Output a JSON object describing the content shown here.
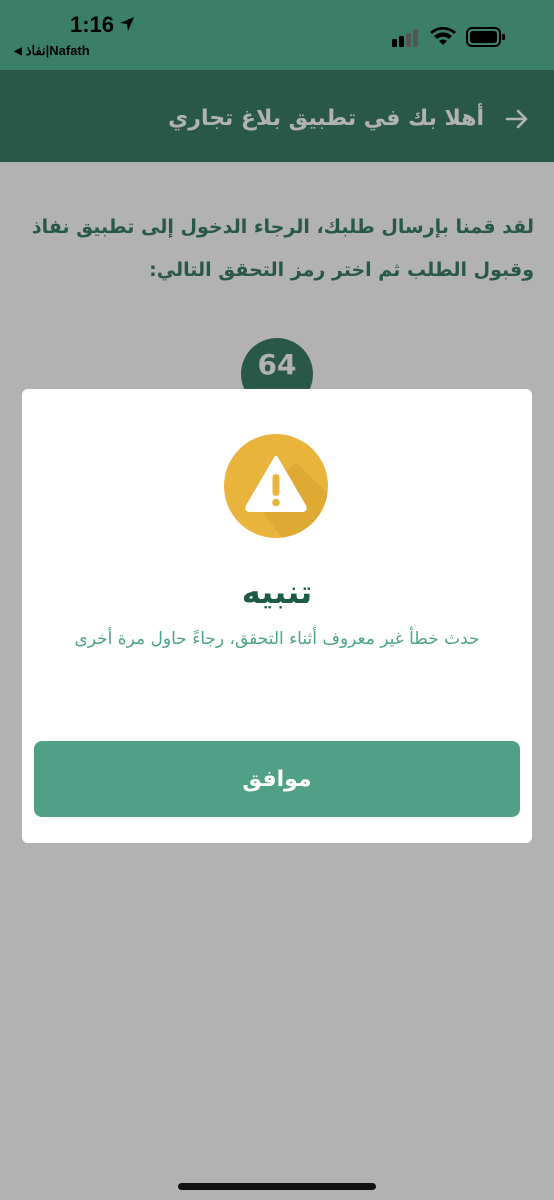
{
  "status_bar": {
    "time": "1:16",
    "back_app": "نفاذ|Nafath"
  },
  "header": {
    "title": "أهلا بك في تطبيق بلاغ تجاري"
  },
  "content": {
    "instructions": "لقد قمنا بإرسال طلبك، الرجاء الدخول إلى تطبيق نفاذ وقبول الطلب ثم اختر رمز التحقق التالي:",
    "verification_code": "64"
  },
  "dialog": {
    "icon": "warning-icon",
    "title": "تنبيه",
    "message": "حدث خطأ غير معروف أثناء التحقق، رجاءً حاول مرة أخرى",
    "ok_label": "موافق"
  },
  "colors": {
    "header": "#3c7f69",
    "primary_button": "#4fa087",
    "warning": "#e8b43c"
  }
}
